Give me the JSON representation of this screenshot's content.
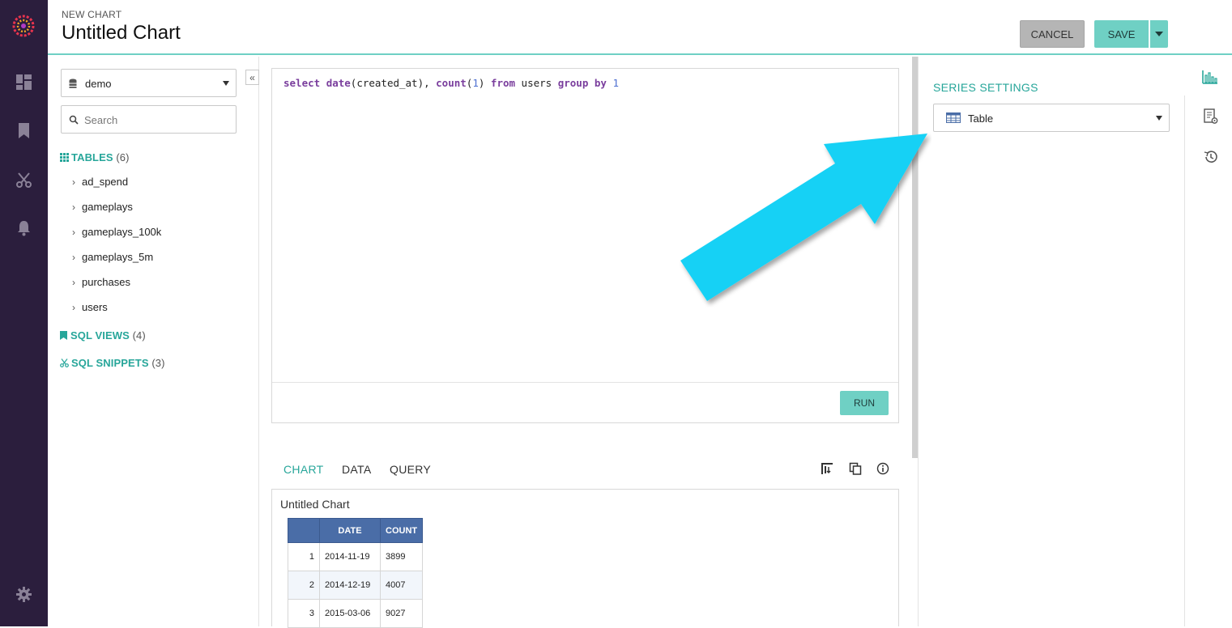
{
  "header": {
    "kicker": "NEW CHART",
    "title": "Untitled Chart",
    "cancel_label": "CANCEL",
    "save_label": "SAVE"
  },
  "nav": {
    "icons": [
      "logo",
      "dashboard-icon",
      "bookmark-icon",
      "scissors-icon",
      "bell-icon",
      "gear-icon"
    ]
  },
  "schema": {
    "database": "demo",
    "search_placeholder": "Search",
    "tables_label": "TABLES",
    "tables_count": "(6)",
    "tables": [
      "ad_spend",
      "gameplays",
      "gameplays_100k",
      "gameplays_5m",
      "purchases",
      "users"
    ],
    "views_label": "SQL VIEWS",
    "views_count": "(4)",
    "snippets_label": "SQL SNIPPETS",
    "snippets_count": "(3)"
  },
  "editor": {
    "query": "select date(created_at), count(1) from users group by 1",
    "run_label": "RUN"
  },
  "results": {
    "tabs": [
      "CHART",
      "DATA",
      "QUERY"
    ],
    "active_tab": "CHART",
    "chart_title": "Untitled Chart",
    "columns": [
      "",
      "DATE",
      "COUNT"
    ],
    "rows": [
      [
        "1",
        "2014-11-19",
        "3899"
      ],
      [
        "2",
        "2014-12-19",
        "4007"
      ],
      [
        "3",
        "2015-03-06",
        "9027"
      ]
    ]
  },
  "series": {
    "title": "SERIES SETTINGS",
    "selected_type": "Table"
  },
  "colors": {
    "accent": "#27a69a",
    "button_teal": "#6fd0c4",
    "nav_bg": "#2b1e3d",
    "table_header": "#4a6da7",
    "arrow": "#19d1f5"
  }
}
